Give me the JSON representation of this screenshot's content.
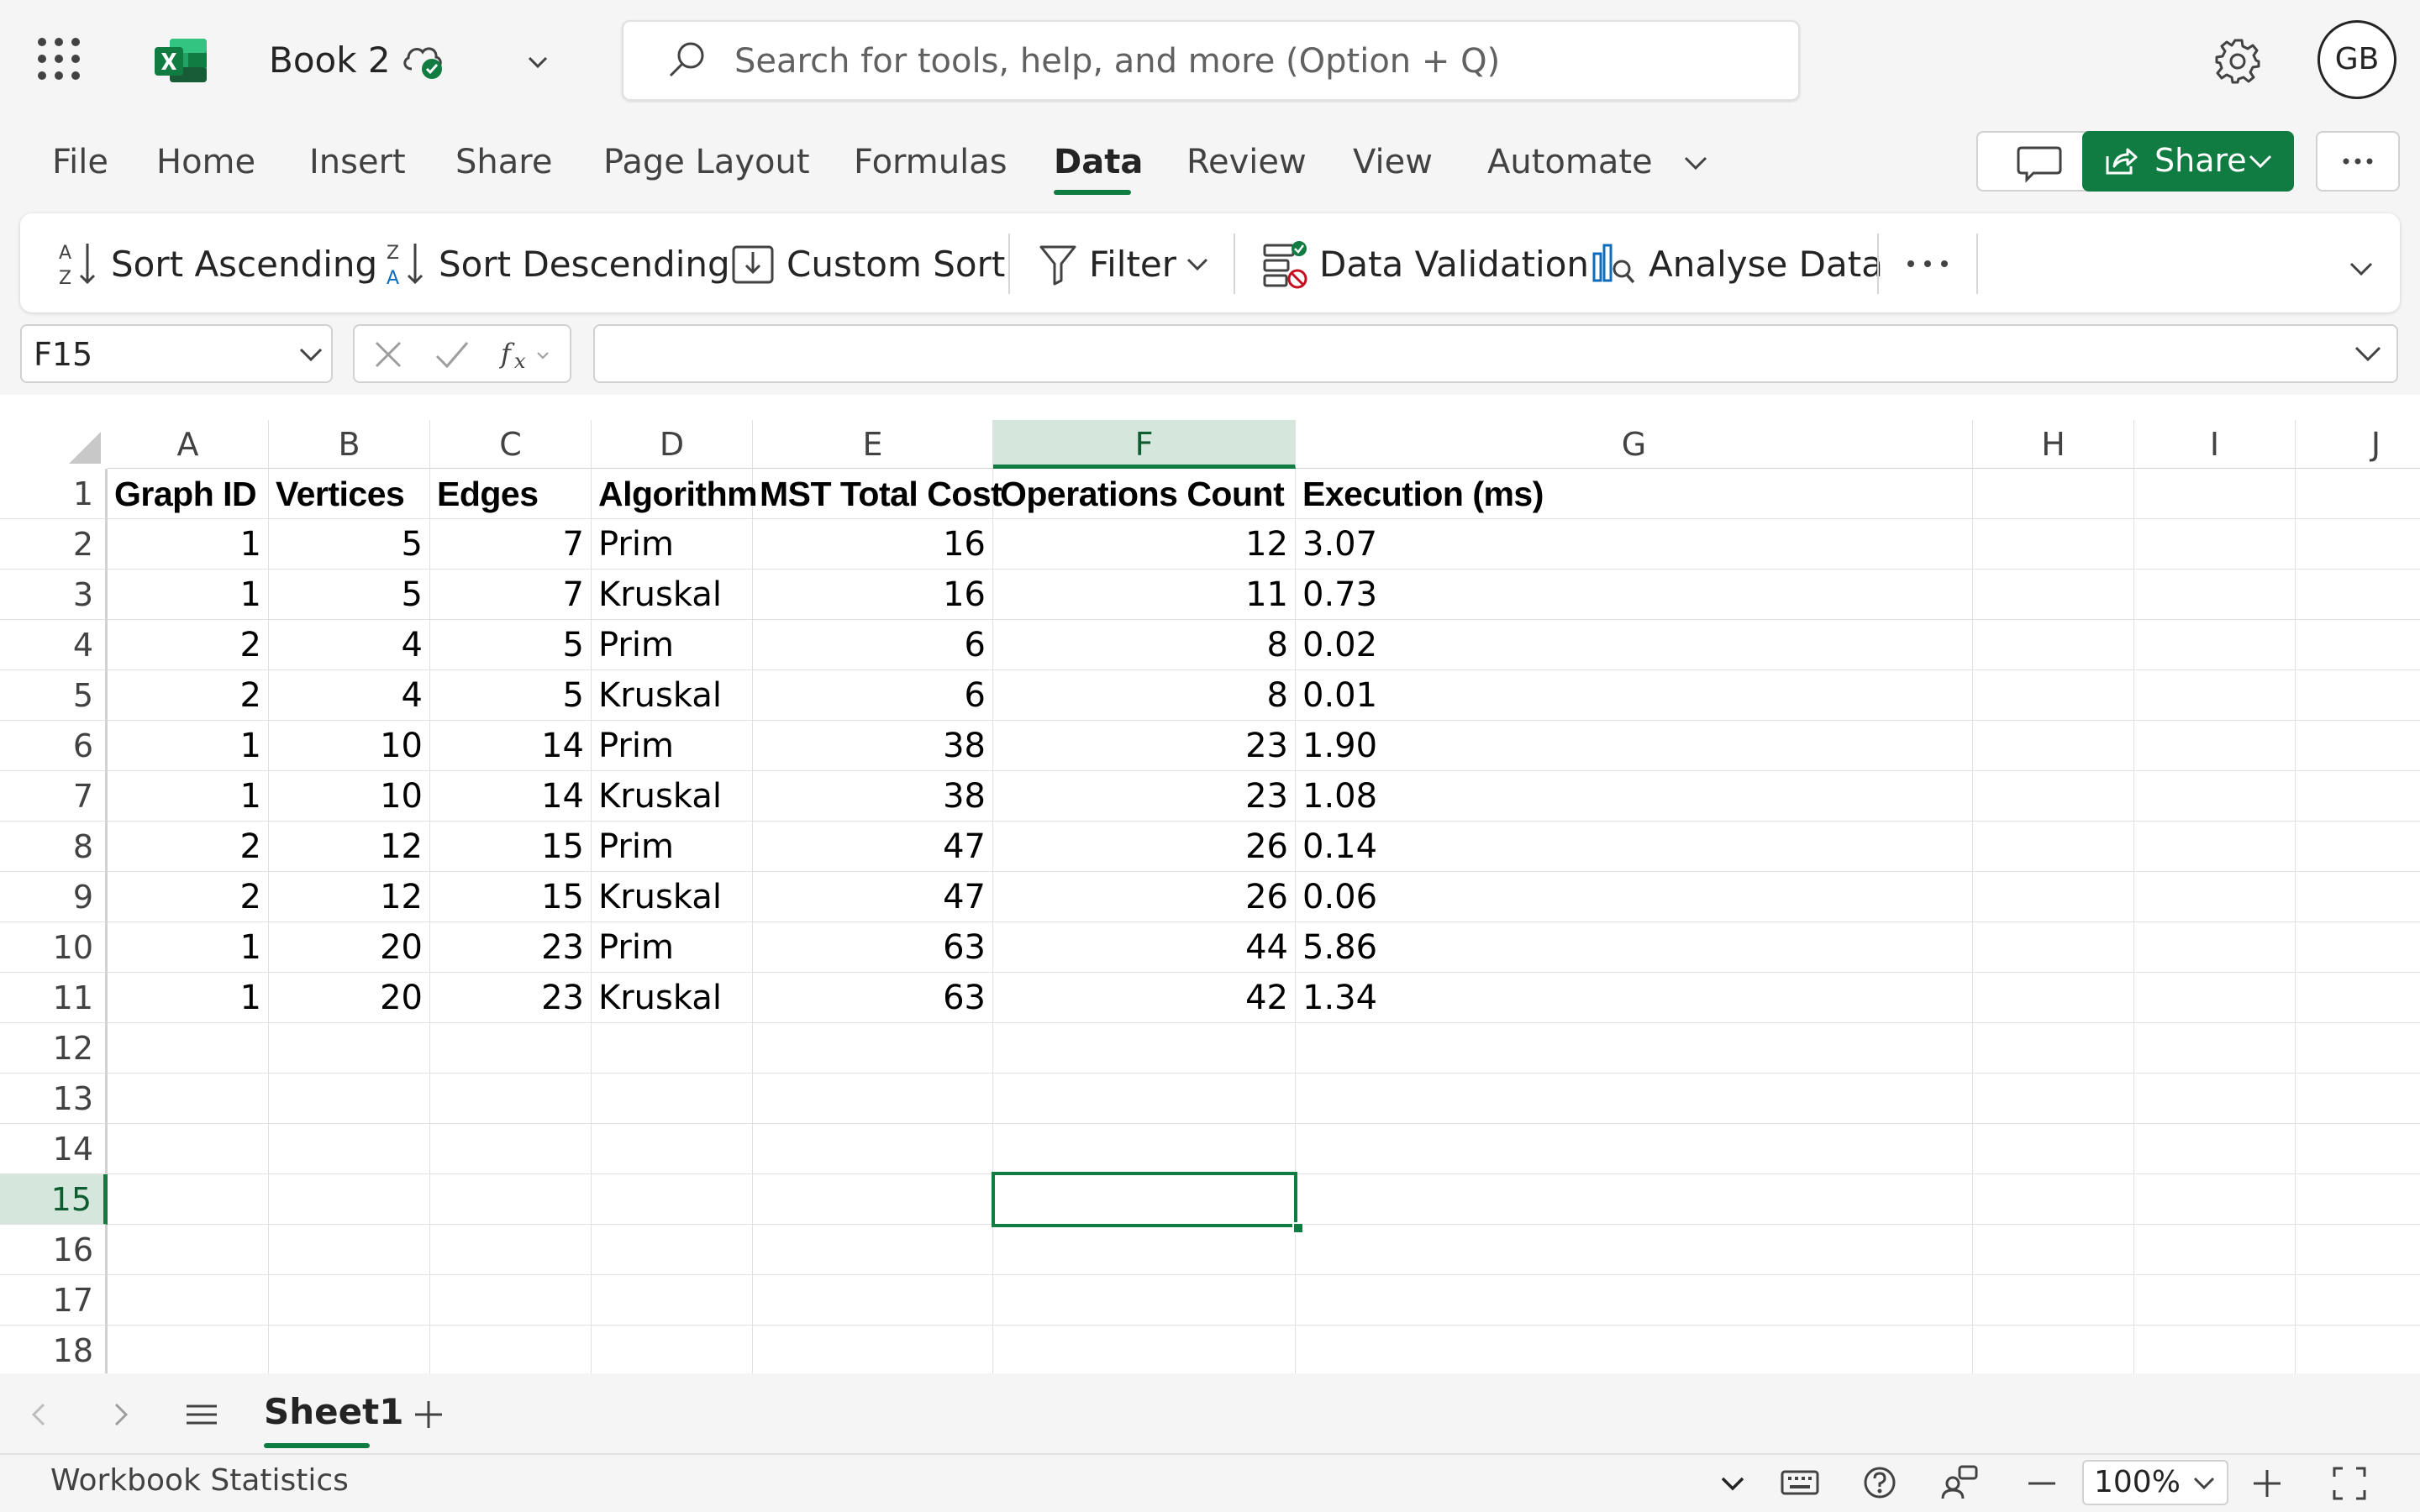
{
  "app": {
    "title": "Book 2",
    "search_placeholder": "Search for tools, help, and more (Option + Q)",
    "avatar_initials": "GB"
  },
  "tabs": [
    {
      "label": "File"
    },
    {
      "label": "Home"
    },
    {
      "label": "Insert"
    },
    {
      "label": "Share"
    },
    {
      "label": "Page Layout"
    },
    {
      "label": "Formulas"
    },
    {
      "label": "Data",
      "active": true
    },
    {
      "label": "Review"
    },
    {
      "label": "View"
    },
    {
      "label": "Automate"
    }
  ],
  "share_label": "Share",
  "ribbon": {
    "sort_asc": "Sort Ascending",
    "sort_desc": "Sort Descending",
    "custom_sort": "Custom Sort",
    "filter": "Filter",
    "data_validation": "Data Validation",
    "analyse_data": "Analyse Data"
  },
  "formula_bar": {
    "name_box": "F15",
    "formula": ""
  },
  "columns": [
    "A",
    "B",
    "C",
    "D",
    "E",
    "F",
    "G",
    "H",
    "I",
    "J"
  ],
  "selected_column": "F",
  "row_numbers": [
    "1",
    "2",
    "3",
    "4",
    "5",
    "6",
    "7",
    "8",
    "9",
    "10",
    "11",
    "12",
    "13",
    "14",
    "15",
    "16",
    "17",
    "18"
  ],
  "selected_row": "15",
  "sheet": {
    "headers": [
      "Graph ID",
      "Vertices",
      "Edges",
      "Algorithm",
      "MST Total Cost",
      "Operations Count",
      "Execution  (ms)"
    ],
    "rows": [
      [
        "1",
        "5",
        "7",
        "Prim",
        "16",
        "12",
        "3.07"
      ],
      [
        "1",
        "5",
        "7",
        "Kruskal",
        "16",
        "11",
        "0.73"
      ],
      [
        "2",
        "4",
        "5",
        "Prim",
        "6",
        "8",
        "0.02"
      ],
      [
        "2",
        "4",
        "5",
        "Kruskal",
        "6",
        "8",
        "0.01"
      ],
      [
        "1",
        "10",
        "14",
        "Prim",
        "38",
        "23",
        "1.90"
      ],
      [
        "1",
        "10",
        "14",
        "Kruskal",
        "38",
        "23",
        "1.08"
      ],
      [
        "2",
        "12",
        "15",
        "Prim",
        "47",
        "26",
        "0.14"
      ],
      [
        "2",
        "12",
        "15",
        "Kruskal",
        "47",
        "26",
        "0.06"
      ],
      [
        "1",
        "20",
        "23",
        "Prim",
        "63",
        "44",
        "5.86"
      ],
      [
        "1",
        "20",
        "23",
        "Kruskal",
        "63",
        "42",
        "1.34"
      ]
    ]
  },
  "sheet_tabs": {
    "active": "Sheet1"
  },
  "status": {
    "text": "Workbook Statistics",
    "zoom": "100%"
  },
  "colors": {
    "accent": "#107c41",
    "selection_fill": "#d5e7dc"
  }
}
